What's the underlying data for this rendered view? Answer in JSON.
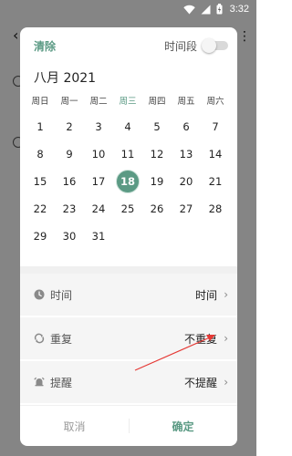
{
  "status_bar": {
    "time": "3:32"
  },
  "dialog": {
    "clear_label": "清除",
    "period_label": "时间段",
    "period_enabled": false,
    "month_title": "八月 2021",
    "weekdays": [
      "周日",
      "周一",
      "周二",
      "周三",
      "周四",
      "周五",
      "周六"
    ],
    "today_weekday_index": 3,
    "weeks": [
      [
        "1",
        "2",
        "3",
        "4",
        "5",
        "6",
        "7"
      ],
      [
        "8",
        "9",
        "10",
        "11",
        "12",
        "13",
        "14"
      ],
      [
        "15",
        "16",
        "17",
        "18",
        "19",
        "20",
        "21"
      ],
      [
        "22",
        "23",
        "24",
        "25",
        "26",
        "27",
        "28"
      ],
      [
        "29",
        "30",
        "31",
        "",
        "",
        "",
        ""
      ]
    ],
    "selected_day": "18",
    "options": [
      {
        "icon": "clock-icon",
        "label": "时间",
        "value": "时间"
      },
      {
        "icon": "repeat-icon",
        "label": "重复",
        "value": "不重复"
      },
      {
        "icon": "alarm-icon",
        "label": "提醒",
        "value": "不提醒"
      }
    ],
    "cancel_label": "取消",
    "confirm_label": "确定"
  },
  "colors": {
    "accent": "#5b9a84",
    "annotation_arrow": "#e53935"
  }
}
